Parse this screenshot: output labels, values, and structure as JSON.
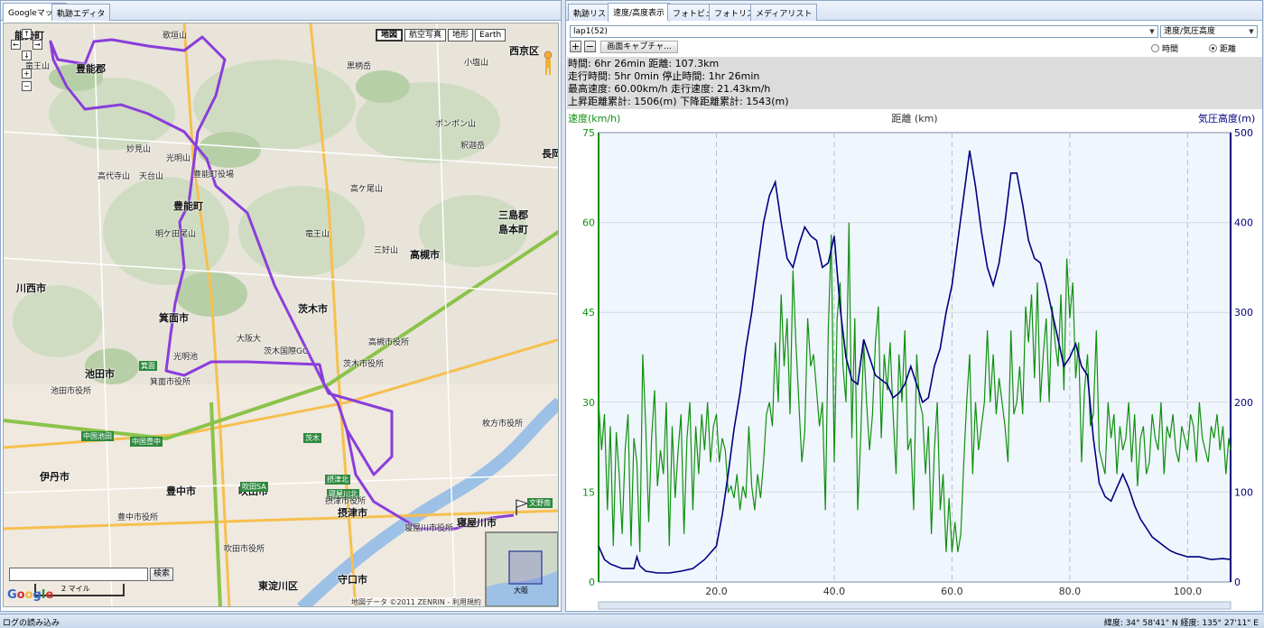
{
  "left_tabs": [
    {
      "label": "Googleマップ",
      "active": true
    },
    {
      "label": "軌跡エディタ",
      "active": false
    }
  ],
  "right_tabs": [
    {
      "label": "軌跡リスト",
      "active": false
    },
    {
      "label": "速度/高度表示",
      "active": true
    },
    {
      "label": "フォトビュー",
      "active": false
    },
    {
      "label": "フォトリスト",
      "active": false
    },
    {
      "label": "メディアリスト",
      "active": false
    }
  ],
  "map": {
    "types": [
      {
        "label": "地図",
        "active": true
      },
      {
        "label": "航空写真",
        "active": false
      },
      {
        "label": "地形",
        "active": false
      },
      {
        "label": "Earth",
        "active": false
      }
    ],
    "nav": {
      "up": "↑",
      "down": "↓",
      "left": "←",
      "right": "→",
      "zoom_in": "+",
      "zoom_out": "−"
    },
    "search_button": "検索",
    "search_value": "",
    "scale_label": "2 マイル",
    "logo": "Google",
    "attribution": "地図データ ©2011 ZENRIN - 利用規約",
    "minimap_label": "大阪",
    "labels": [
      {
        "t": "能勢町",
        "k": "big"
      },
      {
        "t": "豊能郡",
        "k": "big"
      },
      {
        "t": "豊能町",
        "k": "big"
      },
      {
        "t": "川西市",
        "k": "big"
      },
      {
        "t": "箕面市",
        "k": "big"
      },
      {
        "t": "池田市",
        "k": "big"
      },
      {
        "t": "茨木市",
        "k": "big"
      },
      {
        "t": "高槻市",
        "k": "big"
      },
      {
        "t": "三島郡",
        "k": "big"
      },
      {
        "t": "島本町",
        "k": "big"
      },
      {
        "t": "西京区",
        "k": "big"
      },
      {
        "t": "長岡",
        "k": "big"
      },
      {
        "t": "伊丹市",
        "k": "big"
      },
      {
        "t": "豊中市",
        "k": "big"
      },
      {
        "t": "吹田市",
        "k": "big"
      },
      {
        "t": "摂津市",
        "k": "big"
      },
      {
        "t": "寝屋川市",
        "k": "big"
      },
      {
        "t": "守口市",
        "k": "big"
      },
      {
        "t": "東淀川区",
        "k": "big"
      },
      {
        "t": "歌垣山",
        "k": ""
      },
      {
        "t": "竜王山",
        "k": ""
      },
      {
        "t": "妙見山",
        "k": ""
      },
      {
        "t": "光明山",
        "k": ""
      },
      {
        "t": "天台山",
        "k": ""
      },
      {
        "t": "高代寺山",
        "k": ""
      },
      {
        "t": "黒柄岳",
        "k": ""
      },
      {
        "t": "小塩山",
        "k": ""
      },
      {
        "t": "ポンポン山",
        "k": ""
      },
      {
        "t": "釈迦岳",
        "k": ""
      },
      {
        "t": "高ケ尾山",
        "k": ""
      },
      {
        "t": "竜王山",
        "k": ""
      },
      {
        "t": "明ケ田尾山",
        "k": ""
      },
      {
        "t": "三好山",
        "k": ""
      },
      {
        "t": "大阪大",
        "k": ""
      },
      {
        "t": "茨木国際GC",
        "k": ""
      },
      {
        "t": "光明池",
        "k": ""
      },
      {
        "t": "箕面",
        "k": "station"
      },
      {
        "t": "中国池田",
        "k": "station"
      },
      {
        "t": "中国豊中",
        "k": "station"
      },
      {
        "t": "吹田SA",
        "k": "station"
      },
      {
        "t": "摂津北",
        "k": "station"
      },
      {
        "t": "茨木",
        "k": "station"
      },
      {
        "t": "寝屋川北",
        "k": "station"
      },
      {
        "t": "文野南",
        "k": "station"
      },
      {
        "t": "高槻市役所",
        "k": ""
      },
      {
        "t": "茨木市役所",
        "k": ""
      },
      {
        "t": "枚方市役所",
        "k": ""
      },
      {
        "t": "豊能町役場",
        "k": ""
      },
      {
        "t": "箕面市役所",
        "k": ""
      },
      {
        "t": "池田市役所",
        "k": ""
      },
      {
        "t": "吹田市役所",
        "k": ""
      },
      {
        "t": "豊中市役所",
        "k": ""
      },
      {
        "t": "摂津市役所",
        "k": ""
      },
      {
        "t": "寝屋川市役所",
        "k": ""
      }
    ]
  },
  "toolbar": {
    "lap": "lap1(52)",
    "mode": "速度/気圧高度",
    "capture_label": "画面キャプチャ...",
    "zoom_in": "+",
    "zoom_out": "−",
    "radio_time": "時間",
    "radio_distance": "距離",
    "selected": "distance"
  },
  "stats": [
    "時間: 6hr 26min  距離: 107.3km",
    "走行時間: 5hr 0min  停止時間: 1hr 26min",
    "最高速度: 60.00km/h  走行速度: 21.43km/h",
    "上昇距離累計: 1506(m)  下降距離累計: 1543(m)"
  ],
  "colors": {
    "speed": "#109010",
    "altitude": "#000080",
    "route": "#8a3ddb",
    "grid": "#b8bec8"
  },
  "chart_data": {
    "type": "line",
    "title": "距離 (km)",
    "xlabel": "距離 (km)",
    "ylabel_left": "速度(km/h)",
    "ylabel_right": "気圧高度(m)",
    "xlim": [
      0,
      107.3
    ],
    "ylim_left": [
      0,
      75
    ],
    "ylim_right": [
      0,
      500
    ],
    "x_ticks": [
      20.0,
      40.0,
      60.0,
      80.0,
      100.0
    ],
    "y_left_ticks": [
      0,
      15,
      30,
      45,
      60,
      75
    ],
    "y_right_ticks": [
      0,
      100,
      200,
      300,
      400,
      500
    ],
    "grid": true,
    "altitude": {
      "name": "気圧高度",
      "x": [
        0,
        1,
        2,
        4,
        6,
        6.5,
        7,
        8,
        10,
        12,
        14,
        16,
        18,
        20,
        21,
        22,
        23,
        24,
        25,
        26,
        27,
        28,
        29,
        30,
        31,
        32,
        33,
        34,
        35,
        36,
        37,
        38,
        39,
        40,
        41,
        42,
        43,
        44,
        45,
        46,
        47,
        48,
        49,
        50,
        51,
        52,
        53,
        54,
        55,
        56,
        57,
        58,
        59,
        60,
        61,
        62,
        63,
        64,
        65,
        66,
        67,
        68,
        69,
        70,
        71,
        72,
        73,
        74,
        75,
        76,
        77,
        78,
        79,
        80,
        81,
        82,
        83,
        84,
        85,
        86,
        87,
        88,
        89,
        90,
        91,
        92,
        93,
        94,
        95,
        96,
        97,
        98,
        99,
        100,
        102,
        104,
        106,
        107.3
      ],
      "values": [
        40,
        25,
        20,
        15,
        15,
        28,
        18,
        12,
        10,
        10,
        12,
        15,
        25,
        40,
        75,
        120,
        170,
        210,
        260,
        300,
        350,
        400,
        430,
        445,
        400,
        360,
        350,
        375,
        395,
        385,
        380,
        350,
        355,
        385,
        305,
        250,
        225,
        220,
        270,
        250,
        230,
        225,
        220,
        205,
        210,
        220,
        240,
        220,
        200,
        205,
        240,
        260,
        300,
        330,
        380,
        430,
        480,
        440,
        390,
        350,
        330,
        355,
        400,
        455,
        455,
        420,
        380,
        360,
        355,
        330,
        300,
        270,
        240,
        250,
        265,
        240,
        230,
        160,
        110,
        95,
        90,
        105,
        120,
        105,
        85,
        70,
        60,
        50,
        45,
        40,
        35,
        32,
        30,
        28,
        28,
        25,
        26,
        25
      ]
    },
    "speed": {
      "name": "速度",
      "x": [
        0,
        0.5,
        1,
        1.5,
        2,
        2.5,
        3,
        3.5,
        4,
        4.5,
        5,
        5.5,
        6,
        6.5,
        7,
        7.5,
        8,
        8.5,
        9,
        9.5,
        10,
        10.5,
        11,
        11.5,
        12,
        12.5,
        13,
        13.5,
        14,
        14.5,
        15,
        15.5,
        16,
        16.5,
        17,
        17.5,
        18,
        18.5,
        19,
        19.5,
        20,
        20.5,
        21,
        21.5,
        22,
        22.5,
        23,
        23.5,
        24,
        24.5,
        25,
        25.5,
        26,
        26.5,
        27,
        27.5,
        28,
        28.5,
        29,
        29.5,
        30,
        30.5,
        31,
        31.5,
        32,
        32.5,
        33,
        33.5,
        34,
        34.5,
        35,
        35.5,
        36,
        36.5,
        37,
        37.5,
        38,
        38.5,
        39,
        39.5,
        40,
        40.5,
        41,
        41.5,
        42,
        42.5,
        43,
        43.5,
        44,
        44.5,
        45,
        45.5,
        46,
        46.5,
        47,
        47.5,
        48,
        48.5,
        49,
        49.5,
        50,
        50.5,
        51,
        51.5,
        52,
        52.5,
        53,
        53.5,
        54,
        54.5,
        55,
        55.5,
        56,
        56.5,
        57,
        57.5,
        58,
        58.5,
        59,
        59.5,
        60,
        60.5,
        61,
        61.5,
        62,
        62.5,
        63,
        63.5,
        64,
        64.5,
        65,
        65.5,
        66,
        66.5,
        67,
        67.5,
        68,
        68.5,
        69,
        69.5,
        70,
        70.5,
        71,
        71.5,
        72,
        72.5,
        73,
        73.5,
        74,
        74.5,
        75,
        75.5,
        76,
        76.5,
        77,
        77.5,
        78,
        78.5,
        79,
        79.5,
        80,
        80.5,
        81,
        81.5,
        82,
        82.5,
        83,
        83.5,
        84,
        84.5,
        85,
        85.5,
        86,
        86.5,
        87,
        87.5,
        88,
        88.5,
        89,
        89.5,
        90,
        90.5,
        91,
        91.5,
        92,
        92.5,
        93,
        93.5,
        94,
        94.5,
        95,
        95.5,
        96,
        96.5,
        97,
        97.5,
        98,
        98.5,
        99,
        99.5,
        100,
        100.5,
        101,
        101.5,
        102,
        102.5,
        103,
        103.5,
        104,
        104.5,
        105,
        105.5,
        106,
        106.5,
        107,
        107.3
      ],
      "values": [
        30,
        22,
        28,
        12,
        26,
        6,
        25,
        18,
        8,
        22,
        28,
        6,
        24,
        20,
        5,
        38,
        26,
        10,
        24,
        32,
        16,
        22,
        18,
        30,
        6,
        26,
        14,
        22,
        28,
        8,
        24,
        30,
        12,
        26,
        18,
        28,
        22,
        30,
        20,
        26,
        28,
        20,
        24,
        22,
        15,
        16,
        14,
        18,
        12,
        16,
        14,
        26,
        16,
        12,
        18,
        14,
        20,
        28,
        30,
        26,
        40,
        30,
        48,
        36,
        44,
        28,
        52,
        40,
        30,
        20,
        25,
        44,
        36,
        38,
        32,
        26,
        30,
        12,
        42,
        58,
        20,
        44,
        50,
        36,
        30,
        60,
        24,
        44,
        12,
        24,
        40,
        30,
        22,
        28,
        40,
        46,
        24,
        38,
        32,
        40,
        28,
        18,
        38,
        30,
        42,
        22,
        24,
        12,
        38,
        30,
        28,
        18,
        26,
        8,
        22,
        30,
        12,
        18,
        5,
        14,
        5,
        10,
        5,
        8,
        20,
        30,
        38,
        18,
        30,
        22,
        26,
        30,
        42,
        30,
        38,
        28,
        34,
        30,
        26,
        20,
        42,
        28,
        30,
        36,
        28,
        46,
        40,
        48,
        34,
        50,
        30,
        38,
        44,
        30,
        46,
        40,
        36,
        48,
        32,
        54,
        44,
        50,
        34,
        40,
        20,
        32,
        38,
        26,
        28,
        42,
        22,
        20,
        18,
        30,
        24,
        28,
        18,
        26,
        22,
        24,
        30,
        20,
        28,
        16,
        24,
        26,
        18,
        20,
        28,
        24,
        22,
        30,
        18,
        26,
        24,
        28,
        22,
        20,
        26,
        24,
        22,
        28,
        26,
        20,
        30,
        24,
        22,
        20,
        26,
        24,
        28,
        22,
        26,
        18,
        24,
        22,
        20,
        26,
        24
      ]
    }
  }
}
